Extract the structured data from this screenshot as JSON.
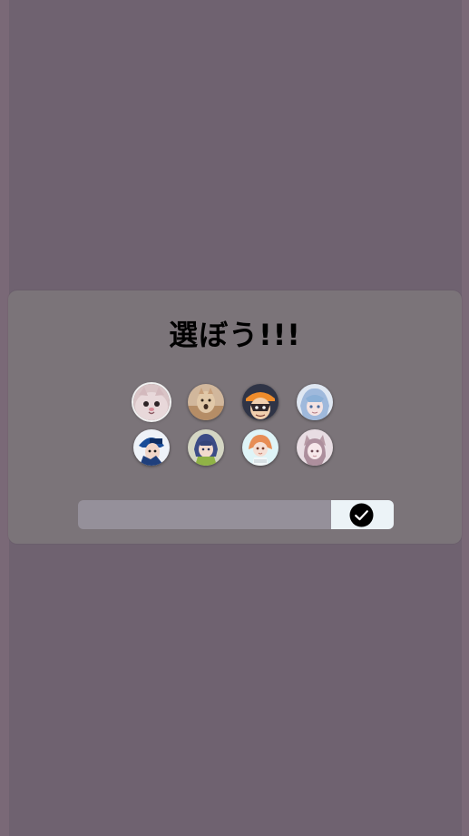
{
  "modal": {
    "title": "選ぼう!!!",
    "avatars": [
      {
        "icon": "cat-face-avatar-icon",
        "selected": true
      },
      {
        "icon": "cat-meme-avatar-icon",
        "selected": false
      },
      {
        "icon": "orange-hat-character-avatar-icon",
        "selected": false
      },
      {
        "icon": "blue-hair-character-avatar-icon",
        "selected": false
      },
      {
        "icon": "blue-cap-character-avatar-icon",
        "selected": false
      },
      {
        "icon": "green-character-avatar-icon",
        "selected": false
      },
      {
        "icon": "orange-hair-character-avatar-icon",
        "selected": false
      },
      {
        "icon": "cat-ears-character-avatar-icon",
        "selected": false
      }
    ],
    "name_input": {
      "value": "",
      "placeholder": ""
    },
    "submit_icon": "check-circle-icon"
  },
  "colors": {
    "page_background": "#6f6270",
    "modal_background": "#7b7479",
    "input_background": "#95909a",
    "submit_background": "#ecf3f7"
  }
}
